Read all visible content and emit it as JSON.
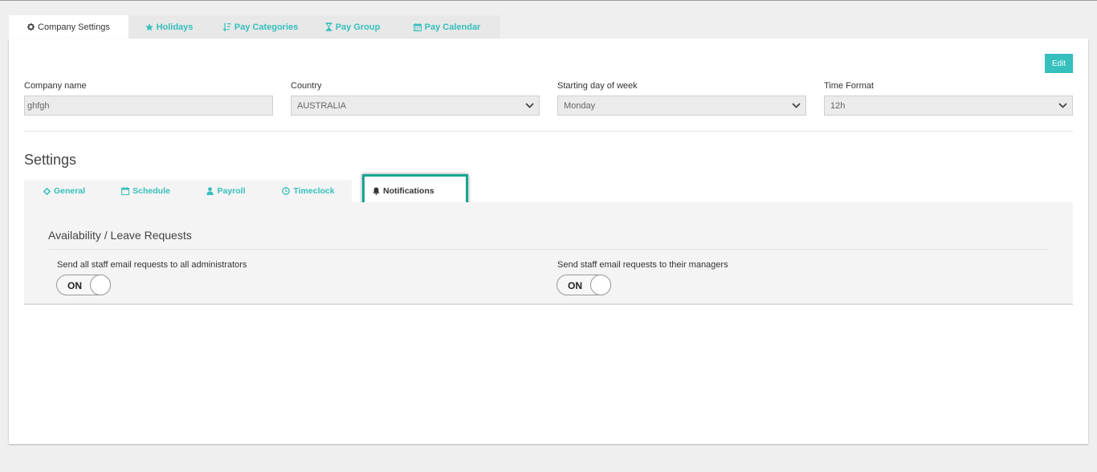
{
  "top_tabs": [
    {
      "label": "Company Settings",
      "icon": "gear-icon",
      "active": true
    },
    {
      "label": "Holidays",
      "icon": "star-icon"
    },
    {
      "label": "Pay Categories",
      "icon": "sort-icon"
    },
    {
      "label": "Pay Group",
      "icon": "hourglass-icon"
    },
    {
      "label": "Pay Calendar",
      "icon": "calendar-icon"
    }
  ],
  "edit_label": "Edit",
  "fields": {
    "company_name": {
      "label": "Company name",
      "value": "ghfgh"
    },
    "country": {
      "label": "Country",
      "value": "AUSTRALIA"
    },
    "start_day": {
      "label": "Starting day of week",
      "value": "Monday"
    },
    "time_format": {
      "label": "Time Format",
      "value": "12h"
    }
  },
  "settings_title": "Settings",
  "settings_tabs": [
    {
      "label": "General",
      "icon": "gear-icon"
    },
    {
      "label": "Schedule",
      "icon": "calendar-icon"
    },
    {
      "label": "Payroll",
      "icon": "user-icon"
    },
    {
      "label": "Timeclock",
      "icon": "clock-icon"
    },
    {
      "label": "Notifications",
      "icon": "bell-icon",
      "active": true
    }
  ],
  "section_title": "Availability / Leave Requests",
  "options": [
    {
      "label": "Send all staff email requests to all administrators",
      "state": "ON"
    },
    {
      "label": "Send staff email requests to their managers",
      "state": "ON"
    }
  ],
  "colors": {
    "accent": "#35bfbd",
    "highlight_border": "#16a692"
  }
}
